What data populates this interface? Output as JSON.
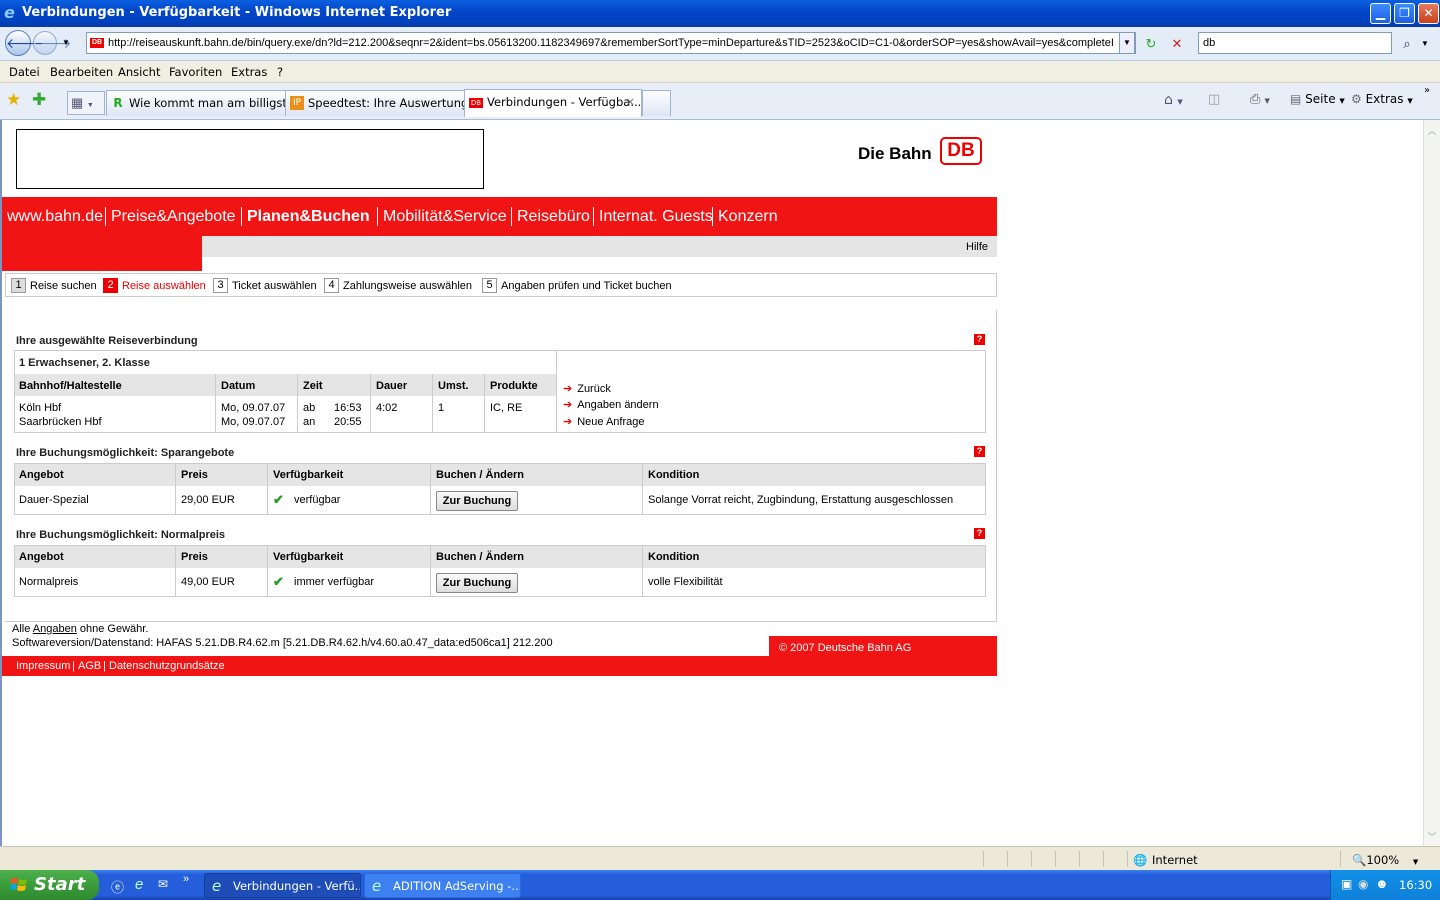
{
  "window": {
    "title": "Verbindungen - Verfügbarkeit - Windows Internet Explorer"
  },
  "addressbar": {
    "url": "http://reiseauskunft.bahn.de/bin/query.exe/dn?ld=212.200&seqnr=2&ident=bs.05613200.1182349697&rememberSortType=minDeparture&sTID=2523&oCID=C1-0&orderSOP=yes&showAvail=yes&completeI",
    "search_value": "db"
  },
  "menubar": [
    "Datei",
    "Bearbeiten",
    "Ansicht",
    "Favoriten",
    "Extras",
    "?"
  ],
  "tabs": [
    {
      "label": "Wie kommt man am billigsten ...",
      "icon": "R"
    },
    {
      "label": "Speedtest: Ihre Auswertung",
      "icon": "IP"
    },
    {
      "label": "Verbindungen - Verfügba...",
      "icon": "DB"
    }
  ],
  "commandbar": {
    "page": "Seite",
    "tools": "Extras"
  },
  "site": {
    "logo_text": "Die Bahn",
    "logo_mark": "DB",
    "nav": [
      "www.bahn.de",
      "Preise&Angebote",
      "Planen&Buchen",
      "Mobilität&Service",
      "Reisebüro",
      "Internat. Guests",
      "Konzern"
    ],
    "help": "Hilfe",
    "steps": [
      {
        "num": "1",
        "label": "Reise suchen"
      },
      {
        "num": "2",
        "label": "Reise auswählen"
      },
      {
        "num": "3",
        "label": "Ticket auswählen"
      },
      {
        "num": "4",
        "label": "Zahlungsweise auswählen"
      },
      {
        "num": "5",
        "label": "Angaben prüfen und Ticket buchen"
      }
    ]
  },
  "connection": {
    "heading": "Ihre ausgewählte Reiseverbindung",
    "passengers": "1 Erwachsener, 2. Klasse",
    "columns": [
      "Bahnhof/Haltestelle",
      "Datum",
      "Zeit",
      "Dauer",
      "Umst.",
      "Produkte"
    ],
    "from": {
      "station": "Köln Hbf",
      "date": "Mo, 09.07.07",
      "type": "ab",
      "time": "16:53"
    },
    "to": {
      "station": "Saarbrücken Hbf",
      "date": "Mo, 09.07.07",
      "type": "an",
      "time": "20:55"
    },
    "duration": "4:02",
    "changes": "1",
    "products": "IC, RE",
    "links": [
      "Zurück",
      "Angaben ändern",
      "Neue Anfrage"
    ]
  },
  "offers": {
    "columns": [
      "Angebot",
      "Preis",
      "Verfügbarkeit",
      "Buchen / Ändern",
      "Kondition"
    ],
    "sparangebote": {
      "heading": "Ihre Buchungsmöglichkeit: Sparangebote",
      "name": "Dauer-Spezial",
      "price": "29,00 EUR",
      "availability": "verfügbar",
      "button": "Zur Buchung",
      "condition": "Solange Vorrat reicht, Zugbindung, Erstattung ausgeschlossen"
    },
    "normalpreis": {
      "heading": "Ihre Buchungsmöglichkeit: Normalpreis",
      "name": "Normalpreis",
      "price": "49,00 EUR",
      "availability": "immer verfügbar",
      "button": "Zur Buchung",
      "condition": "volle Flexibilität"
    }
  },
  "footer": {
    "disclaimer_pre": "Alle",
    "disclaimer_link": "Angaben",
    "disclaimer_post": "ohne Gewähr.",
    "version": "Softwareversion/Datenstand: HAFAS 5.21.DB.R4.62.m [5.21.DB.R4.62.h/v4.60.a0.47_data:ed506ca1] 212.200",
    "copyright": "© 2007 Deutsche Bahn AG",
    "links": [
      "Impressum",
      "AGB",
      "Datenschutzgrundsätze"
    ]
  },
  "statusbar": {
    "zone": "Internet",
    "zoom": "100%"
  },
  "taskbar": {
    "start": "Start",
    "items": [
      "Verbindungen - Verfü...",
      "ADITION AdServing -..."
    ],
    "clock": "16:30"
  },
  "colors": {
    "db_red": "#f01414",
    "xp_blue": "#245edb"
  }
}
